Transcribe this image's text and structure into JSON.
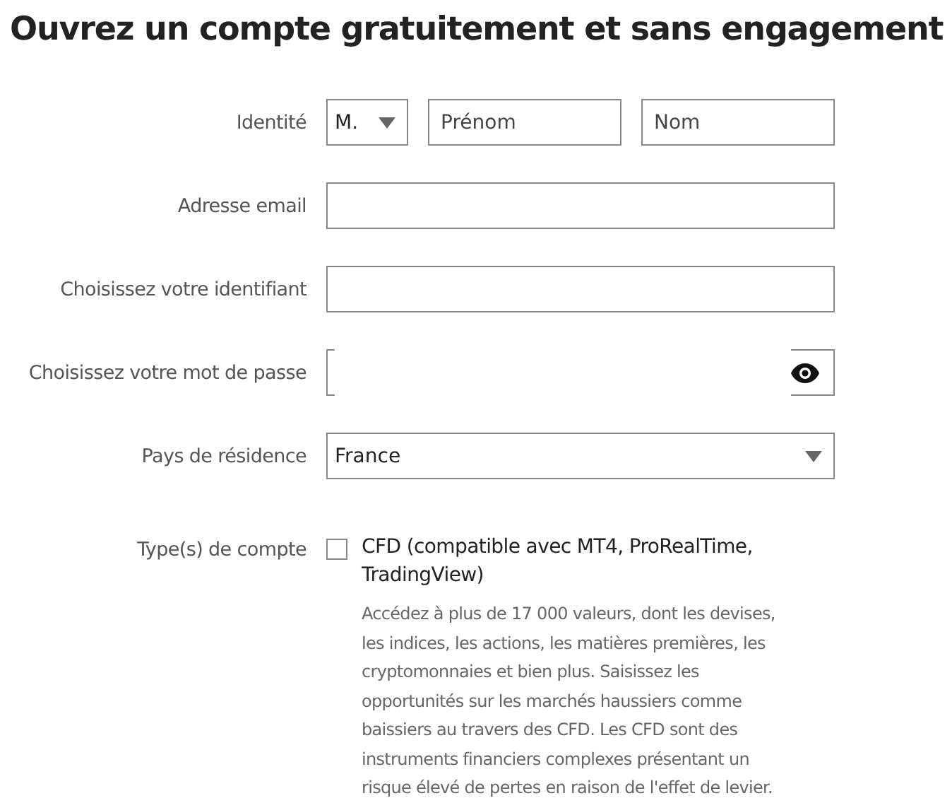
{
  "title": "Ouvrez un compte gratuitement et sans engagement",
  "fields": [
    {
      "kind": "identity",
      "label": "Identité",
      "civility": "M.",
      "first_name_placeholder": "Prénom",
      "last_name_placeholder": "Nom"
    },
    {
      "kind": "text",
      "label": "Adresse email"
    },
    {
      "kind": "text",
      "label": "Choisissez votre identifiant"
    },
    {
      "kind": "password",
      "label": "Choisissez votre mot de passe"
    },
    {
      "kind": "select",
      "label": "Pays de résidence",
      "value": "France"
    },
    {
      "kind": "checkbox",
      "label": "Type(s) de compte",
      "option": "CFD (compatible avec MT4, ProRealTime, TradingView)",
      "checked": false,
      "description": "Accédez à plus de 17 000 valeurs, dont les devises, les indices, les actions, les matières premières, les cryptomonnaies et bien plus. Saisissez les opportunités sur les marchés haussiers comme baissiers au travers des CFD. Les CFD sont des instruments financiers complexes présentant un risque élevé de pertes en raison de l'effet de levier."
    }
  ]
}
